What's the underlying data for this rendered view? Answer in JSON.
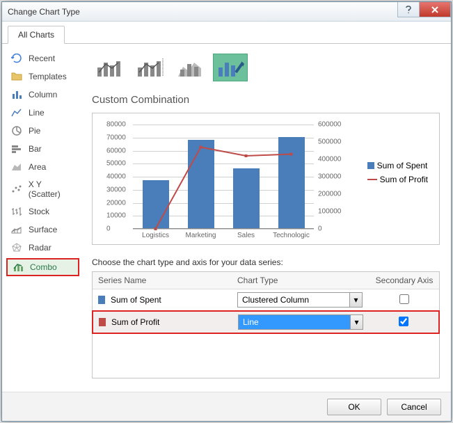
{
  "title": "Change Chart Type",
  "tab": "All Charts",
  "sidebar": {
    "items": [
      {
        "label": "Recent"
      },
      {
        "label": "Templates"
      },
      {
        "label": "Column"
      },
      {
        "label": "Line"
      },
      {
        "label": "Pie"
      },
      {
        "label": "Bar"
      },
      {
        "label": "Area"
      },
      {
        "label": "X Y (Scatter)"
      },
      {
        "label": "Stock"
      },
      {
        "label": "Surface"
      },
      {
        "label": "Radar"
      },
      {
        "label": "Combo"
      }
    ]
  },
  "main": {
    "section_title": "Custom Combination",
    "series_label": "Choose the chart type and axis for your data series:",
    "grid_head": {
      "name": "Series Name",
      "type": "Chart Type",
      "axis": "Secondary Axis"
    },
    "rows": [
      {
        "name": "Sum of Spent",
        "type": "Clustered Column",
        "secondary": false
      },
      {
        "name": "Sum of Profit",
        "type": "Line",
        "secondary": true
      }
    ]
  },
  "footer": {
    "ok": "OK",
    "cancel": "Cancel"
  },
  "chart_data": {
    "type": "combo",
    "categories": [
      "Logistics",
      "Marketing",
      "Sales",
      "Technologic"
    ],
    "series": [
      {
        "name": "Sum of Spent",
        "type": "bar",
        "axis": "primary",
        "values": [
          37000,
          68000,
          46000,
          70000
        ]
      },
      {
        "name": "Sum of Profit",
        "type": "line",
        "axis": "secondary",
        "values": [
          0,
          470000,
          420000,
          430000
        ]
      }
    ],
    "ylabel": "",
    "ylim": [
      0,
      80000
    ],
    "ystep": 10000,
    "y2lim": [
      0,
      600000
    ],
    "y2step": 100000,
    "legend": [
      "Sum of Spent",
      "Sum of Profit"
    ]
  }
}
